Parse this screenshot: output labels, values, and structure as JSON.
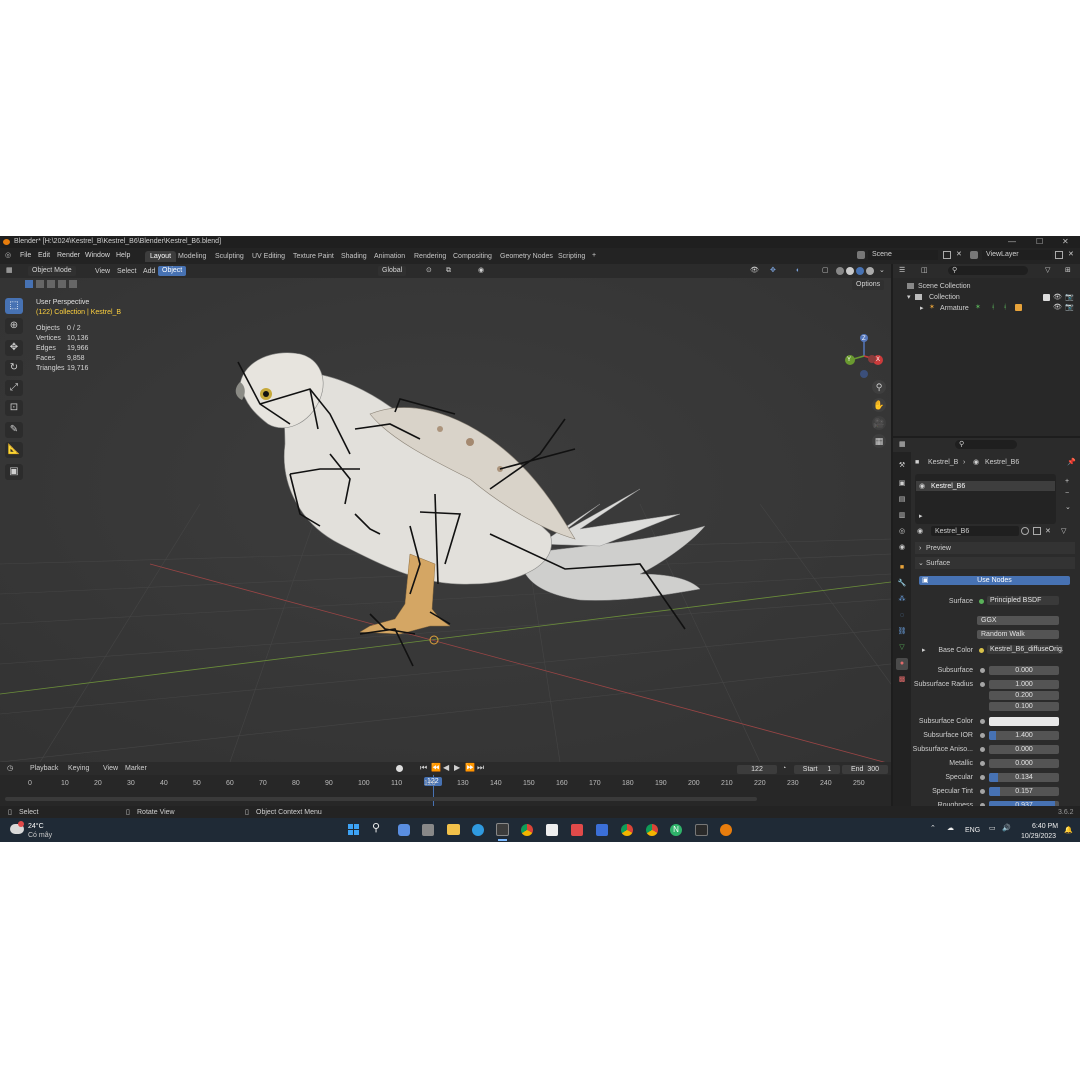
{
  "window": {
    "title": "Blender* [H:\\2024\\Kestrel_B\\Kestrel_B6\\Blender\\Kestrel_B6.blend]",
    "controls": [
      "—",
      "☐",
      "✕"
    ]
  },
  "menus": [
    "File",
    "Edit",
    "Render",
    "Window",
    "Help"
  ],
  "workspaces": [
    "Layout",
    "Modeling",
    "Sculpting",
    "UV Editing",
    "Texture Paint",
    "Shading",
    "Animation",
    "Rendering",
    "Compositing",
    "Geometry Nodes",
    "Scripting"
  ],
  "workspace_add": "+",
  "scene": {
    "name": "Scene",
    "view_layer": "ViewLayer"
  },
  "viewport": {
    "mode": "Object Mode",
    "menus": [
      "View",
      "Select",
      "Add",
      "Object"
    ],
    "transform_orientation": "Global",
    "options": "Options",
    "info_line1": "User Perspective",
    "info_line2": "(122) Collection | Kestrel_B",
    "stats": [
      {
        "label": "Objects",
        "value": "0 / 2"
      },
      {
        "label": "Vertices",
        "value": "10,136"
      },
      {
        "label": "Edges",
        "value": "19,966"
      },
      {
        "label": "Faces",
        "value": "9,858"
      },
      {
        "label": "Triangles",
        "value": "19,716"
      }
    ],
    "gizmo": {
      "y": "Y",
      "x": "X",
      "z": "Z"
    }
  },
  "timeline": {
    "menus": [
      "Playback",
      "Keying",
      "View",
      "Marker"
    ],
    "current_frame": "122",
    "start_label": "Start",
    "start": "1",
    "end_label": "End",
    "end": "300",
    "ticks": [
      "0",
      "10",
      "20",
      "30",
      "40",
      "50",
      "60",
      "70",
      "80",
      "90",
      "100",
      "110",
      "120",
      "130",
      "140",
      "150",
      "160",
      "170",
      "180",
      "190",
      "200",
      "210",
      "220",
      "230",
      "240",
      "250"
    ],
    "playhead_label": "122"
  },
  "statusbar": {
    "left": "Select",
    "middle": "Rotate View",
    "right": "Object Context Menu",
    "version": "3.6.2"
  },
  "outliner": {
    "scene_collection": "Scene Collection",
    "collection": "Collection",
    "armature": "Armature"
  },
  "properties": {
    "breadcrumb_object": "Kestrel_B",
    "breadcrumb_material": "Kestrel_B6",
    "slot": "Kestrel_B6",
    "material_name": "Kestrel_B6",
    "preview": "Preview",
    "surface_panel": "Surface",
    "use_nodes": "Use Nodes",
    "surface_label": "Surface",
    "surface_value": "Principled BSDF",
    "distribution": "GGX",
    "subsurface_method": "Random Walk",
    "base_color_label": "Base Color",
    "base_color_value": "Kestrel_B6_diffuseOrig...",
    "rows": [
      {
        "label": "Subsurface",
        "value": "0.000",
        "fill": 0.0
      },
      {
        "label": "Subsurface Radius",
        "value": "1.000",
        "fill": 0.0
      },
      {
        "label": "",
        "value": "0.200",
        "fill": 0.0
      },
      {
        "label": "",
        "value": "0.100",
        "fill": 0.0
      },
      {
        "label": "Subsurface Color",
        "value": "",
        "fill": 0.0
      },
      {
        "label": "Subsurface IOR",
        "value": "1.400",
        "fill": 0.1
      },
      {
        "label": "Subsurface Aniso...",
        "value": "0.000",
        "fill": 0.0
      },
      {
        "label": "Metallic",
        "value": "0.000",
        "fill": 0.0
      },
      {
        "label": "Specular",
        "value": "0.134",
        "fill": 0.134
      },
      {
        "label": "Specular Tint",
        "value": "0.157",
        "fill": 0.157
      },
      {
        "label": "Roughness",
        "value": "0.937",
        "fill": 0.937
      }
    ]
  },
  "taskbar": {
    "weather_temp": "24°C",
    "weather_desc": "Có mây",
    "lang": "ENG",
    "time": "6:40 PM",
    "date": "10/29/2023"
  },
  "colors": {
    "accent": "#4772b3",
    "active_text": "#ffd23f",
    "viewport_bg": "#393939",
    "blender_orange": "#e87d0d"
  }
}
